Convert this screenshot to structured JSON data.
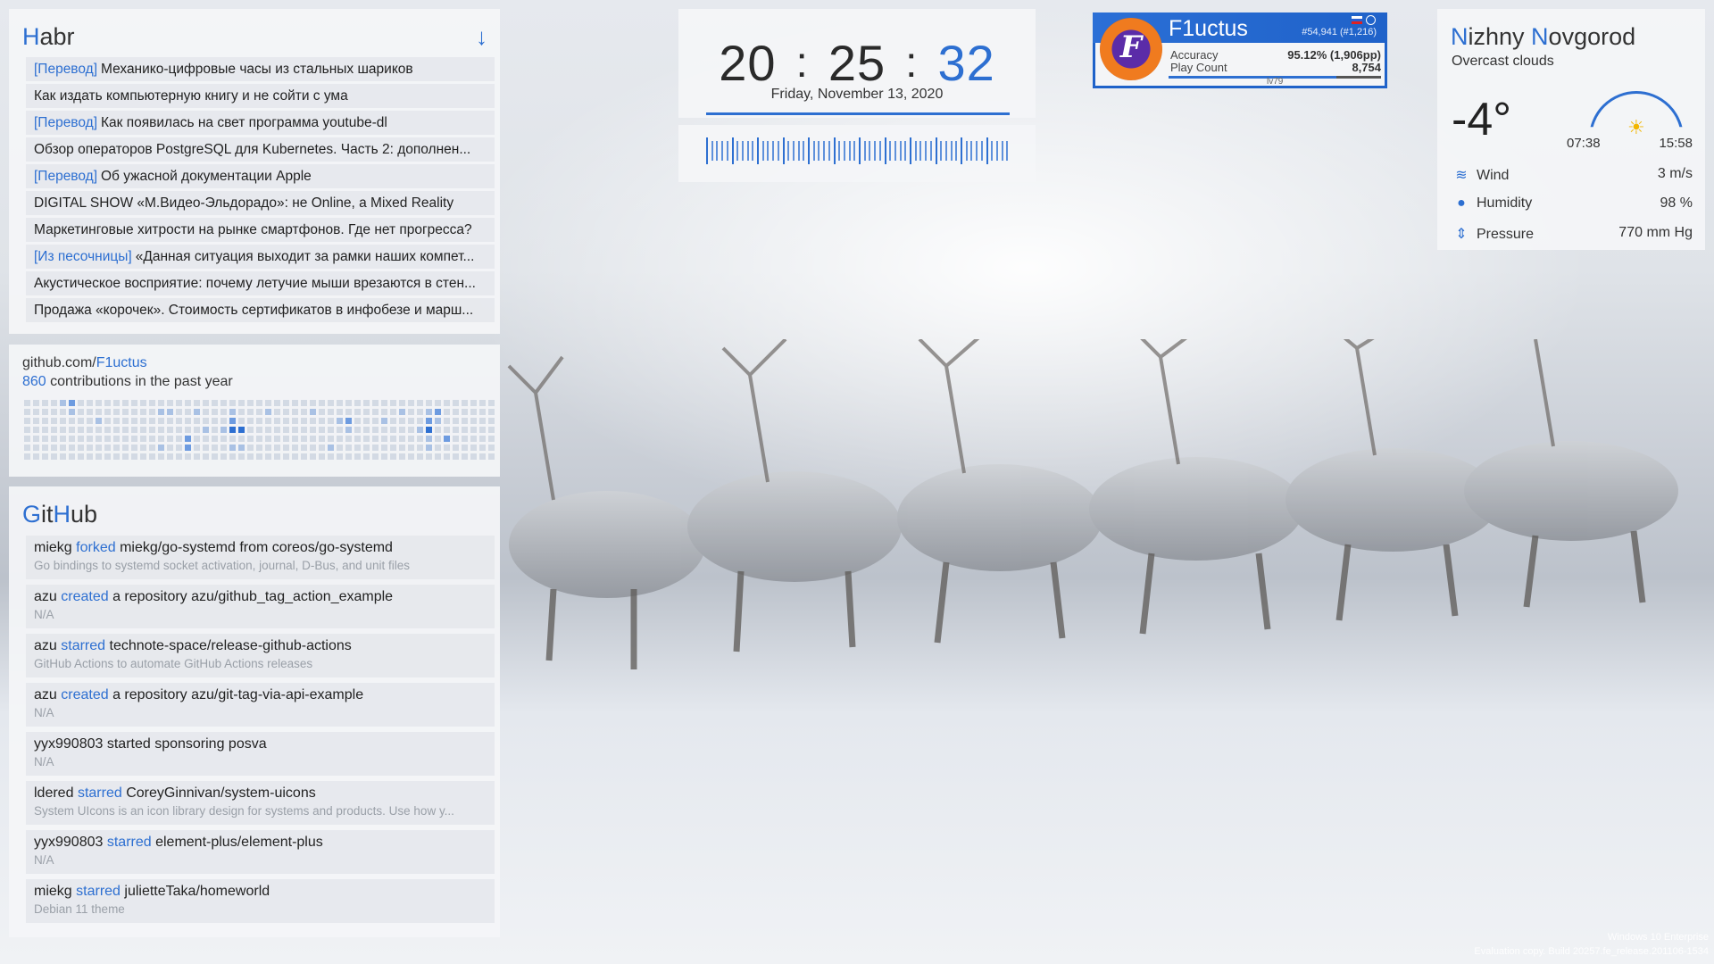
{
  "habr": {
    "title_first": "H",
    "title_rest": "abr",
    "arrow": "↓",
    "items": [
      {
        "tag": "[Перевод]",
        "text": "Механико-цифровые часы из стальных шариков"
      },
      {
        "tag": "",
        "text": "Как издать компьютерную книгу и не сойти с ума"
      },
      {
        "tag": "[Перевод]",
        "text": "Как появилась на свет программа youtube-dl"
      },
      {
        "tag": "",
        "text": "Обзор операторов PostgreSQL для Kubernetes. Часть 2: дополнен..."
      },
      {
        "tag": "[Перевод]",
        "text": "Об ужасной документации Apple"
      },
      {
        "tag": "",
        "text": "DIGITAL SHOW «М.Видео-Эльдорадо»: не Online, a Mixed Reality"
      },
      {
        "tag": "",
        "text": "Маркетинговые хитрости на рынке смартфонов. Где нет прогресса?"
      },
      {
        "tag": "[Из песочницы]",
        "text": "«Данная ситуация выходит за рамки наших компет..."
      },
      {
        "tag": "",
        "text": "Акустическое восприятие: почему летучие мыши врезаются в стен..."
      },
      {
        "tag": "",
        "text": "Продажа «корочек». Стоимость сертификатов в инфобезе и марш..."
      }
    ]
  },
  "contrib": {
    "url_prefix": "github.com/",
    "user": "F1uctus",
    "count": "860",
    "suffix": " contributions in the past year",
    "levels": [
      [
        0,
        0,
        0,
        0,
        1,
        2,
        0,
        0,
        0,
        0,
        0,
        0,
        0,
        0,
        0,
        0,
        0,
        0,
        0,
        0,
        0,
        0,
        0,
        0,
        0,
        0,
        0,
        0,
        0,
        0,
        0,
        0,
        0,
        0,
        0,
        0,
        0,
        0,
        0,
        0,
        0,
        0,
        0,
        0,
        0,
        0,
        0,
        0,
        0,
        0,
        0,
        0,
        0
      ],
      [
        0,
        0,
        0,
        0,
        0,
        1,
        0,
        0,
        0,
        0,
        0,
        0,
        0,
        0,
        0,
        1,
        1,
        0,
        0,
        1,
        0,
        0,
        0,
        1,
        0,
        0,
        0,
        1,
        0,
        0,
        0,
        0,
        1,
        0,
        0,
        0,
        0,
        0,
        0,
        0,
        0,
        0,
        1,
        0,
        0,
        1,
        2,
        0,
        0,
        0,
        0,
        0,
        0
      ],
      [
        0,
        0,
        0,
        0,
        0,
        0,
        0,
        0,
        1,
        0,
        0,
        0,
        0,
        0,
        0,
        0,
        0,
        0,
        0,
        0,
        0,
        0,
        0,
        2,
        0,
        0,
        0,
        0,
        0,
        0,
        0,
        0,
        0,
        0,
        0,
        1,
        2,
        0,
        0,
        0,
        1,
        0,
        0,
        0,
        0,
        2,
        1,
        0,
        0,
        0,
        0,
        0,
        0
      ],
      [
        0,
        0,
        0,
        0,
        0,
        0,
        0,
        0,
        0,
        0,
        0,
        0,
        0,
        0,
        0,
        0,
        0,
        0,
        0,
        0,
        1,
        0,
        1,
        3,
        3,
        0,
        0,
        0,
        0,
        0,
        0,
        0,
        0,
        0,
        0,
        0,
        1,
        0,
        0,
        0,
        0,
        0,
        0,
        0,
        1,
        3,
        0,
        0,
        0,
        0,
        0,
        0,
        0
      ],
      [
        0,
        0,
        0,
        0,
        0,
        0,
        0,
        0,
        0,
        0,
        0,
        0,
        0,
        0,
        0,
        0,
        0,
        0,
        2,
        0,
        0,
        0,
        0,
        0,
        0,
        0,
        0,
        0,
        0,
        0,
        0,
        0,
        0,
        0,
        0,
        0,
        0,
        0,
        0,
        0,
        0,
        0,
        0,
        0,
        0,
        1,
        0,
        2,
        0,
        0,
        0,
        0,
        0
      ],
      [
        0,
        0,
        0,
        0,
        0,
        0,
        0,
        0,
        0,
        0,
        0,
        0,
        0,
        0,
        0,
        1,
        0,
        0,
        2,
        0,
        0,
        0,
        0,
        1,
        1,
        0,
        0,
        0,
        0,
        0,
        0,
        0,
        0,
        0,
        1,
        0,
        0,
        0,
        0,
        0,
        0,
        0,
        0,
        0,
        0,
        1,
        0,
        0,
        0,
        0,
        0,
        0,
        0
      ],
      [
        0,
        0,
        0,
        0,
        0,
        0,
        0,
        0,
        0,
        0,
        0,
        0,
        0,
        0,
        0,
        0,
        0,
        0,
        0,
        0,
        0,
        0,
        0,
        0,
        0,
        0,
        0,
        0,
        0,
        0,
        0,
        0,
        0,
        0,
        0,
        0,
        0,
        0,
        0,
        0,
        0,
        0,
        0,
        0,
        0,
        0,
        0,
        0,
        0,
        0,
        0,
        0,
        0
      ]
    ],
    "colors": [
      "#d3dae4",
      "#a9c1e4",
      "#6d9be0",
      "#2d6fd1"
    ]
  },
  "github": {
    "title_parts": [
      {
        "text": "G",
        "accent": true
      },
      {
        "text": "it",
        "accent": false
      },
      {
        "text": "H",
        "accent": true
      },
      {
        "text": "ub",
        "accent": false
      }
    ],
    "items": [
      {
        "actor": "miekg",
        "verb": "forked",
        "rest": "miekg/go-systemd from coreos/go-systemd",
        "desc": "Go bindings to systemd socket activation, journal, D-Bus, and unit files"
      },
      {
        "actor": "azu",
        "verb": "created",
        "rest": "a repository azu/github_tag_action_example",
        "desc": "N/A"
      },
      {
        "actor": "azu",
        "verb": "starred",
        "rest": "technote-space/release-github-actions",
        "desc": "GitHub Actions to automate GitHub Actions releases"
      },
      {
        "actor": "azu",
        "verb": "created",
        "rest": "a repository azu/git-tag-via-api-example",
        "desc": "N/A"
      },
      {
        "actor": "yyx990803",
        "verb": "",
        "rest": "started sponsoring posva",
        "desc": "N/A"
      },
      {
        "actor": "ldered",
        "verb": "starred",
        "rest": "CoreyGinnivan/system-uicons",
        "desc": "System UIcons is an icon library design for systems and products. Use how y..."
      },
      {
        "actor": "yyx990803",
        "verb": "starred",
        "rest": "element-plus/element-plus",
        "desc": "N/A"
      },
      {
        "actor": "miekg",
        "verb": "starred",
        "rest": "julietteTaka/homeworld",
        "desc": "Debian 11 theme"
      }
    ]
  },
  "clock": {
    "hours": "20",
    "minutes": "25",
    "seconds": "32",
    "sep": ":",
    "date": "Friday, November 13, 2020"
  },
  "osu": {
    "name": "F1uctus",
    "rank": "#54,941 (#1,216)",
    "avatar_letter": "F",
    "accuracy_label": "Accuracy",
    "accuracy_value": "95.12% (1,906pp)",
    "playcount_label": "Play Count",
    "playcount_value": "8,754",
    "level": "lv79",
    "level_progress": 0.79
  },
  "weather": {
    "city_first1": "N",
    "city_rest1": "izhny ",
    "city_first2": "N",
    "city_rest2": "ovgorod",
    "condition": "Overcast clouds",
    "temp": "-4°",
    "sunrise": "07:38",
    "sunset": "15:58",
    "rows": [
      {
        "icon": "wind-icon",
        "label": "Wind",
        "value": "3 m/s"
      },
      {
        "icon": "humidity-icon",
        "label": "Humidity",
        "value": "98 %"
      },
      {
        "icon": "pressure-icon",
        "label": "Pressure",
        "value": "770 mm Hg"
      }
    ]
  },
  "watermark": {
    "line1": "Windows 10 Enterprise",
    "line2": "Evaluation copy. Build 20257.fe_release.201106-1534"
  },
  "colors": {
    "accent": "#2d6fd1"
  }
}
